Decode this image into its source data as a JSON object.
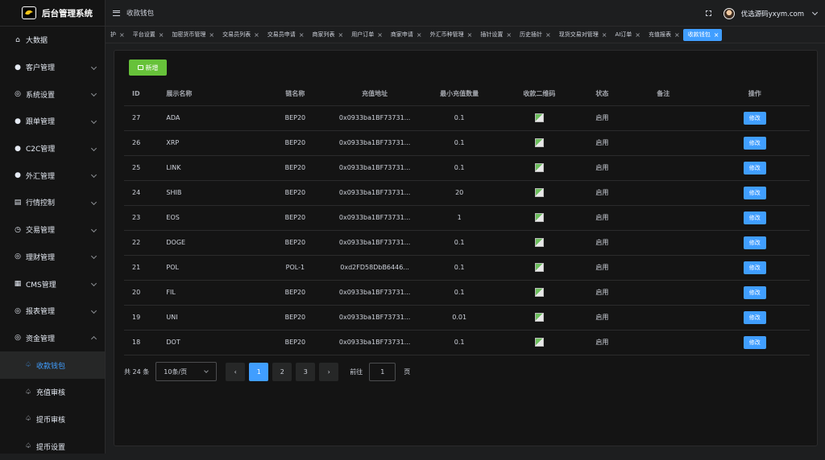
{
  "app": {
    "title": "后台管理系统"
  },
  "header": {
    "breadcrumb": "收款钱包",
    "username": "优选源码yxym.com"
  },
  "sidebar": {
    "items": [
      {
        "label": "大数据",
        "icon": "⌂"
      },
      {
        "label": "客户管理",
        "icon": "●"
      },
      {
        "label": "系统设置",
        "icon": "◎"
      },
      {
        "label": "跟单管理",
        "icon": "●"
      },
      {
        "label": "C2C管理",
        "icon": "●"
      },
      {
        "label": "外汇管理",
        "icon": "●"
      },
      {
        "label": "行情控制",
        "icon": "▤"
      },
      {
        "label": "交易管理",
        "icon": "◷"
      },
      {
        "label": "理财管理",
        "icon": "◎"
      },
      {
        "label": "CMS管理",
        "icon": "▦"
      },
      {
        "label": "报表管理",
        "icon": "◎"
      },
      {
        "label": "资金管理",
        "icon": "◎"
      }
    ],
    "subitems": [
      {
        "label": "收款钱包",
        "icon": "♤"
      },
      {
        "label": "充值审核",
        "icon": "♤"
      },
      {
        "label": "提币审核",
        "icon": "♤"
      },
      {
        "label": "提币设置",
        "icon": "♤"
      }
    ]
  },
  "tabs": [
    "护",
    "平台设置",
    "加密货币管理",
    "交易员列表",
    "交易员申请",
    "商家列表",
    "用户订单",
    "商家申请",
    "外汇币种管理",
    "插针设置",
    "历史插针",
    "现货交易对管理",
    "AI订单",
    "充值报表",
    "收款钱包"
  ],
  "toolbar": {
    "add_label": "新增"
  },
  "table": {
    "headers": [
      "ID",
      "展示名称",
      "链名称",
      "充值地址",
      "最小充值数量",
      "收款二维码",
      "状态",
      "备注",
      "操作"
    ],
    "edit_label": "修改",
    "rows": [
      {
        "id": "27",
        "name": "ADA",
        "chain": "BEP20",
        "addr": "0x0933ba1BF73731...",
        "min": "0.1",
        "status": "启用",
        "note": ""
      },
      {
        "id": "26",
        "name": "XRP",
        "chain": "BEP20",
        "addr": "0x0933ba1BF73731...",
        "min": "0.1",
        "status": "启用",
        "note": ""
      },
      {
        "id": "25",
        "name": "LINK",
        "chain": "BEP20",
        "addr": "0x0933ba1BF73731...",
        "min": "0.1",
        "status": "启用",
        "note": ""
      },
      {
        "id": "24",
        "name": "SHIB",
        "chain": "BEP20",
        "addr": "0x0933ba1BF73731...",
        "min": "20",
        "status": "启用",
        "note": ""
      },
      {
        "id": "23",
        "name": "EOS",
        "chain": "BEP20",
        "addr": "0x0933ba1BF73731...",
        "min": "1",
        "status": "启用",
        "note": ""
      },
      {
        "id": "22",
        "name": "DOGE",
        "chain": "BEP20",
        "addr": "0x0933ba1BF73731...",
        "min": "0.1",
        "status": "启用",
        "note": ""
      },
      {
        "id": "21",
        "name": "POL",
        "chain": "POL-1",
        "addr": "0xd2FD58DbB6446...",
        "min": "0.1",
        "status": "启用",
        "note": ""
      },
      {
        "id": "20",
        "name": "FIL",
        "chain": "BEP20",
        "addr": "0x0933ba1BF73731...",
        "min": "0.1",
        "status": "启用",
        "note": ""
      },
      {
        "id": "19",
        "name": "UNI",
        "chain": "BEP20",
        "addr": "0x0933ba1BF73731...",
        "min": "0.01",
        "status": "启用",
        "note": ""
      },
      {
        "id": "18",
        "name": "DOT",
        "chain": "BEP20",
        "addr": "0x0933ba1BF73731...",
        "min": "0.1",
        "status": "启用",
        "note": ""
      }
    ]
  },
  "pagination": {
    "total": "共 24 条",
    "page_size": "10条/页",
    "prev": "‹",
    "next": "›",
    "pages": [
      "1",
      "2",
      "3"
    ],
    "current": "1",
    "goto_label": "前往",
    "goto_value": "1",
    "page_unit": "页"
  }
}
